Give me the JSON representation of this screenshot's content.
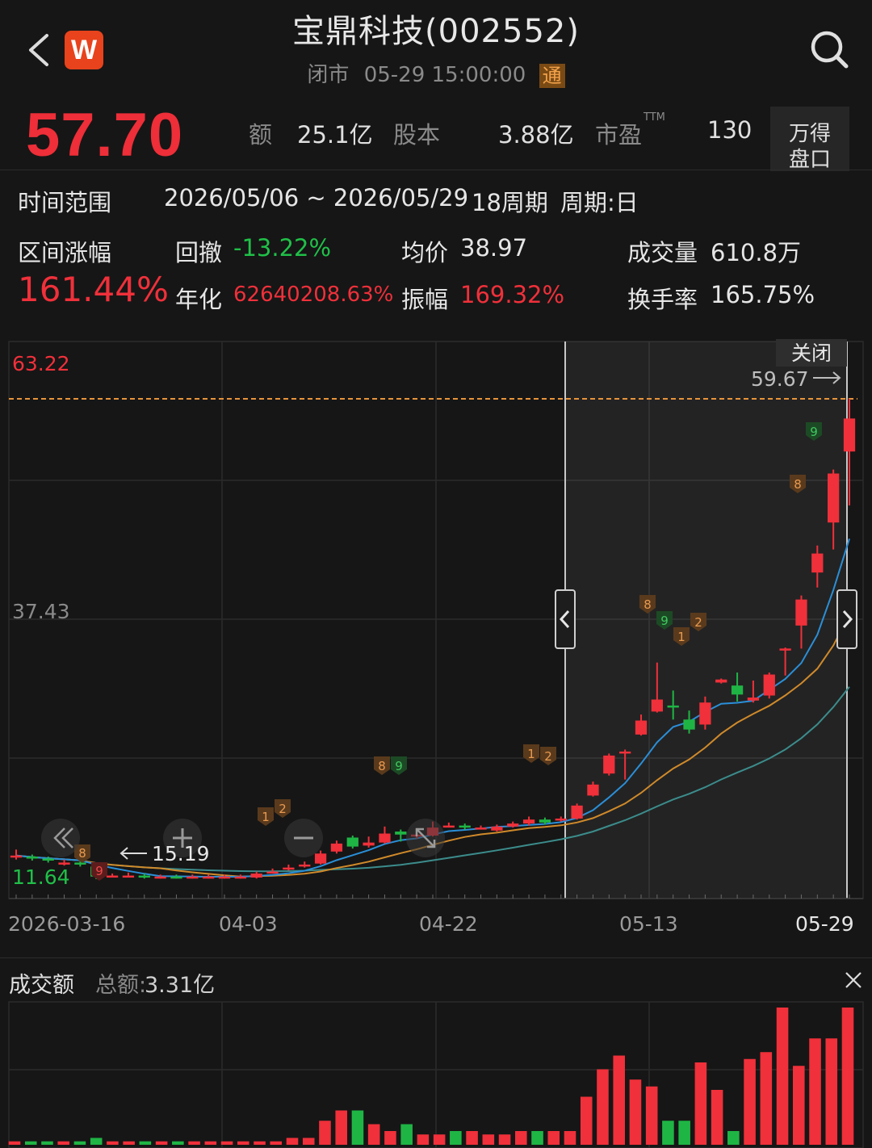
{
  "header": {
    "title": "宝鼎科技(002552)",
    "status": "闭市",
    "datetime": "05-29 15:00:00",
    "tong": "通",
    "logo": "W"
  },
  "quote": {
    "price": "57.70",
    "amount_label": "额",
    "amount_value": "25.1亿",
    "shares_label": "股本",
    "shares_value": "3.88亿",
    "pe_label": "市盈",
    "pe_sup": "TTM",
    "pe_value": "130",
    "wande_line1": "万得",
    "wande_line2": "盘口"
  },
  "range": {
    "label": "时间范围",
    "value": "2026/05/06 ~ 2026/05/29",
    "periods": "18周期",
    "cycle": "周期:日"
  },
  "stats": {
    "change_label": "区间涨幅",
    "change_value": "161.44%",
    "drawdown_label": "回撤",
    "drawdown_value": "-13.22%",
    "annual_label": "年化",
    "annual_value": "62640208.63%",
    "avg_label": "均价",
    "avg_value": "38.97",
    "amp_label": "振幅",
    "amp_value": "169.32%",
    "vol_label": "成交量",
    "vol_value": "610.8万",
    "turnover_label": "换手率",
    "turnover_value": "165.75%"
  },
  "chart": {
    "y_top": "63.22",
    "y_mid": "37.43",
    "y_low": "11.64",
    "close_btn": "关闭",
    "mark_high": "59.67",
    "mark_low": "15.19",
    "x_labels": [
      "2026-03-16",
      "04-03",
      "04-22",
      "05-13",
      "05-29"
    ]
  },
  "volume": {
    "title": "成交额",
    "total_label": "总额:",
    "total_value": "3.31亿"
  },
  "colors": {
    "up": "#f0303a",
    "down": "#1fb545",
    "ma5": "#2a8fd8",
    "ma10": "#d08a2a",
    "ma20": "#3c8c8c",
    "highlight": "#e8943a"
  },
  "chart_data": {
    "type": "candlestick",
    "x_start": "2026-03-16",
    "x_end": "2026-05-29",
    "ylim": [
      11.64,
      63.22
    ],
    "selected_range": [
      "2026-05-06",
      "2026-05-29"
    ],
    "candles": [
      {
        "o": 14.0,
        "c": 14.0,
        "h": 14.6,
        "l": 13.6
      },
      {
        "o": 13.9,
        "c": 13.7,
        "h": 14.1,
        "l": 13.5
      },
      {
        "o": 13.7,
        "c": 13.5,
        "h": 13.9,
        "l": 13.3
      },
      {
        "o": 13.3,
        "c": 13.3,
        "h": 13.6,
        "l": 13.0
      },
      {
        "o": 13.3,
        "c": 13.1,
        "h": 13.4,
        "l": 12.9
      },
      {
        "o": 12.9,
        "c": 11.9,
        "h": 13.0,
        "l": 11.64
      },
      {
        "o": 11.9,
        "c": 12.0,
        "h": 12.2,
        "l": 11.8
      },
      {
        "o": 12.0,
        "c": 12.0,
        "h": 12.3,
        "l": 11.8
      },
      {
        "o": 12.0,
        "c": 11.9,
        "h": 12.2,
        "l": 11.7
      },
      {
        "o": 11.9,
        "c": 11.9,
        "h": 12.1,
        "l": 11.7
      },
      {
        "o": 11.9,
        "c": 11.8,
        "h": 12.1,
        "l": 11.7
      },
      {
        "o": 11.8,
        "c": 11.9,
        "h": 12.1,
        "l": 11.7
      },
      {
        "o": 11.9,
        "c": 11.9,
        "h": 12.1,
        "l": 11.7
      },
      {
        "o": 11.9,
        "c": 11.9,
        "h": 12.1,
        "l": 11.7
      },
      {
        "o": 11.9,
        "c": 11.9,
        "h": 12.1,
        "l": 11.7
      },
      {
        "o": 11.8,
        "c": 12.2,
        "h": 12.4,
        "l": 11.7
      },
      {
        "o": 12.3,
        "c": 12.4,
        "h": 12.7,
        "l": 12.2
      },
      {
        "o": 12.6,
        "c": 12.8,
        "h": 13.1,
        "l": 12.5
      },
      {
        "o": 13.0,
        "c": 13.1,
        "h": 13.4,
        "l": 12.8
      },
      {
        "o": 13.2,
        "c": 14.2,
        "h": 14.5,
        "l": 13.1
      },
      {
        "o": 14.4,
        "c": 15.2,
        "h": 15.5,
        "l": 14.2
      },
      {
        "o": 15.8,
        "c": 14.9,
        "h": 16.0,
        "l": 14.7
      },
      {
        "o": 15.0,
        "c": 15.3,
        "h": 15.9,
        "l": 14.8
      },
      {
        "o": 15.3,
        "c": 16.2,
        "h": 16.9,
        "l": 15.2
      },
      {
        "o": 16.4,
        "c": 16.1,
        "h": 16.6,
        "l": 15.4
      },
      {
        "o": 16.0,
        "c": 16.1,
        "h": 16.4,
        "l": 15.7
      },
      {
        "o": 16.0,
        "c": 16.8,
        "h": 17.4,
        "l": 15.9
      },
      {
        "o": 16.9,
        "c": 17.0,
        "h": 17.3,
        "l": 16.8
      },
      {
        "o": 17.0,
        "c": 16.8,
        "h": 17.2,
        "l": 16.6
      },
      {
        "o": 16.8,
        "c": 16.8,
        "h": 17.0,
        "l": 16.6
      },
      {
        "o": 16.5,
        "c": 16.9,
        "h": 17.1,
        "l": 16.4
      },
      {
        "o": 16.9,
        "c": 17.2,
        "h": 17.4,
        "l": 16.8
      },
      {
        "o": 17.2,
        "c": 17.6,
        "h": 17.9,
        "l": 17.0
      },
      {
        "o": 17.6,
        "c": 17.3,
        "h": 17.8,
        "l": 17.1
      },
      {
        "o": 17.5,
        "c": 17.7,
        "h": 17.9,
        "l": 17.4
      },
      {
        "o": 17.7,
        "c": 19.0,
        "h": 19.2,
        "l": 17.6
      },
      {
        "o": 20.0,
        "c": 21.1,
        "h": 21.4,
        "l": 19.9
      },
      {
        "o": 22.2,
        "c": 24.0,
        "h": 24.2,
        "l": 22.0
      },
      {
        "o": 24.4,
        "c": 24.4,
        "h": 24.6,
        "l": 21.6
      },
      {
        "o": 26.1,
        "c": 27.5,
        "h": 28.1,
        "l": 26.0
      },
      {
        "o": 28.4,
        "c": 29.6,
        "h": 33.3,
        "l": 28.3
      },
      {
        "o": 29.0,
        "c": 28.8,
        "h": 30.5,
        "l": 27.6
      },
      {
        "o": 27.6,
        "c": 26.6,
        "h": 28.5,
        "l": 26.2
      },
      {
        "o": 27.1,
        "c": 29.3,
        "h": 29.9,
        "l": 26.6
      },
      {
        "o": 31.3,
        "c": 31.6,
        "h": 31.7,
        "l": 31.2
      },
      {
        "o": 31.0,
        "c": 30.1,
        "h": 32.3,
        "l": 29.4
      },
      {
        "o": 29.5,
        "c": 29.8,
        "h": 31.5,
        "l": 29.3
      },
      {
        "o": 30.0,
        "c": 32.1,
        "h": 32.3,
        "l": 29.7
      },
      {
        "o": 34.7,
        "c": 34.7,
        "h": 34.8,
        "l": 32.0
      },
      {
        "o": 37.0,
        "c": 39.6,
        "h": 40.0,
        "l": 34.7
      },
      {
        "o": 42.3,
        "c": 44.2,
        "h": 45.0,
        "l": 40.8
      },
      {
        "o": 47.3,
        "c": 52.2,
        "h": 52.6,
        "l": 44.6
      },
      {
        "o": 54.4,
        "c": 57.7,
        "h": 59.67,
        "l": 49.0
      }
    ],
    "volume_bars": [
      1,
      1,
      1,
      1,
      1,
      2,
      1,
      1,
      1,
      1,
      1,
      1,
      1,
      1,
      1,
      1,
      1,
      2,
      2,
      7,
      10,
      10,
      6,
      4,
      6,
      3,
      3,
      4,
      4,
      3,
      3,
      4,
      4,
      4,
      4,
      14,
      22,
      26,
      19,
      17,
      7,
      7,
      24,
      16,
      4,
      25,
      27,
      40,
      23,
      31,
      31,
      40
    ]
  }
}
